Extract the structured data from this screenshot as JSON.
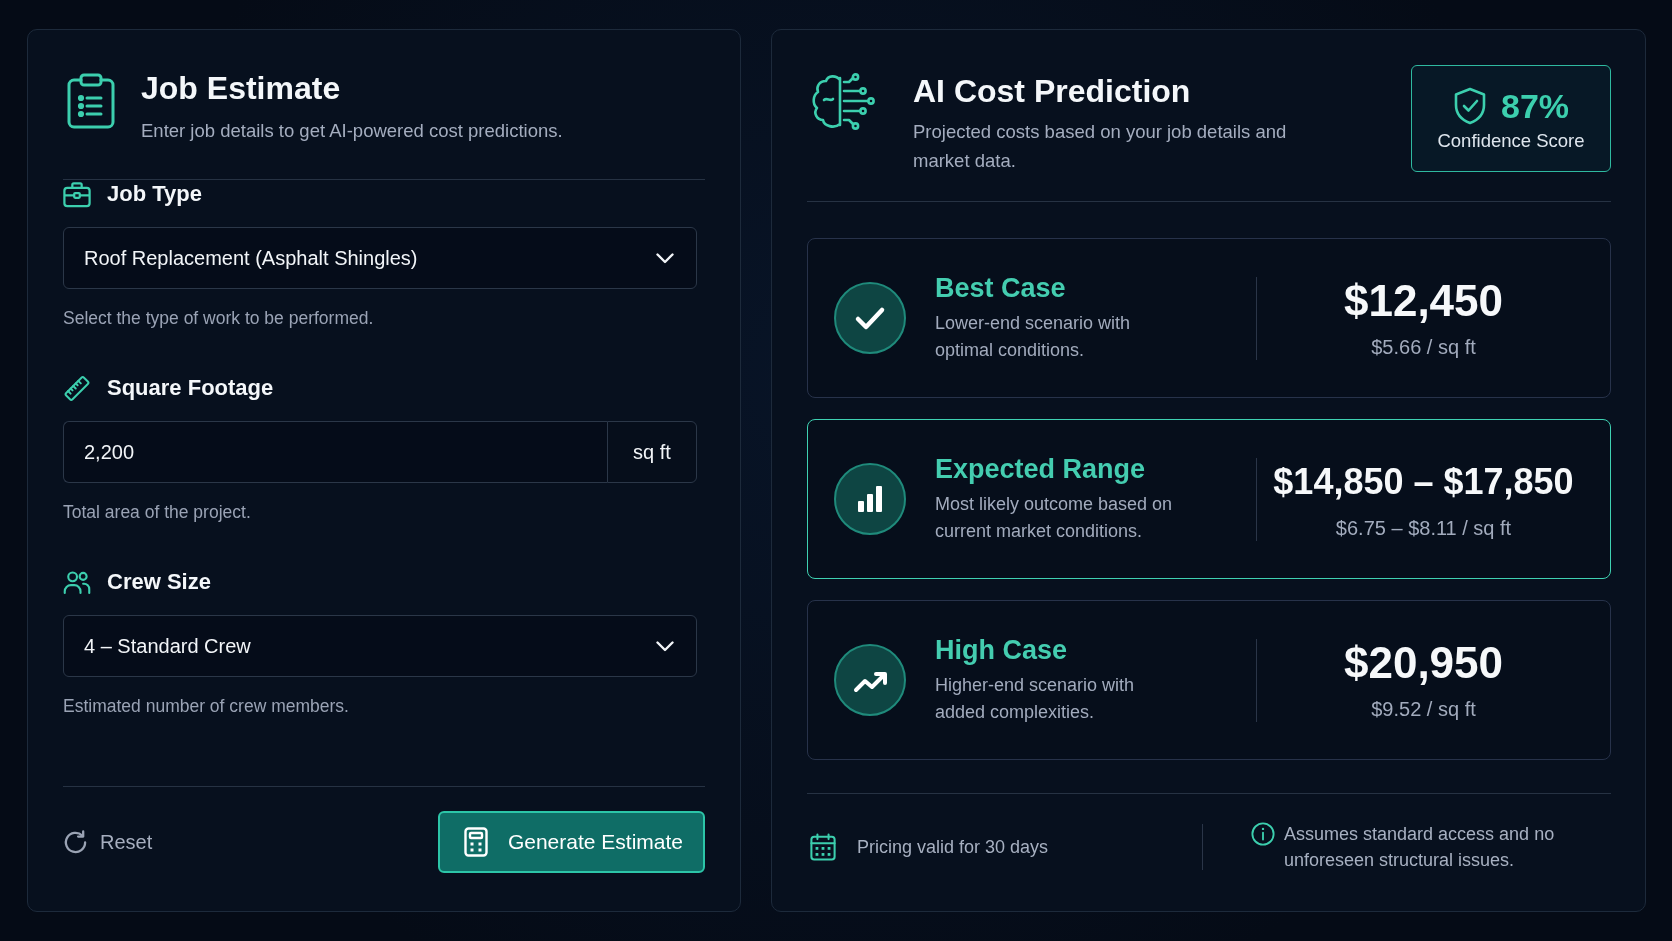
{
  "estimate_panel": {
    "title": "Job Estimate",
    "subtitle": "Enter job details to get AI-powered cost predictions.",
    "fields": [
      {
        "kind": "select",
        "label": "Job Type",
        "value": "Roof Replacement (Asphalt Shingles)",
        "helper": "Select the type of work to be performed."
      },
      {
        "kind": "input",
        "label": "Square Footage",
        "value": "2,200",
        "unit": "sq ft",
        "helper": "Total area of the project."
      },
      {
        "kind": "select",
        "label": "Crew Size",
        "value": "4 – Standard Crew",
        "helper": "Estimated number of crew members."
      }
    ],
    "reset_button": "Reset",
    "generate_button": "Generate Estimate"
  },
  "prediction_panel": {
    "title": "AI Cost Prediction",
    "subtitle": "Projected costs based on your job details and market data.",
    "confidence": {
      "value": "87%",
      "label": "Confidence Score"
    },
    "scenarios": [
      {
        "title": "Best Case",
        "description": "Lower-end scenario with optimal conditions.",
        "cost": "$12,450",
        "per_sqft": "$5.66 / sq ft",
        "highlighted": false
      },
      {
        "title": "Expected Range",
        "description": "Most likely outcome based on current market conditions.",
        "cost": "$14,850 – $17,850",
        "per_sqft": "$6.75 – $8.11 / sq ft",
        "highlighted": true
      },
      {
        "title": "High Case",
        "description": "Higher-end scenario with added complexities.",
        "cost": "$20,950",
        "per_sqft": "$9.52 / sq ft",
        "highlighted": false
      }
    ],
    "notes": [
      "Pricing valid for 30 days",
      "Assumes standard access and no unforeseen structural issues."
    ]
  }
}
